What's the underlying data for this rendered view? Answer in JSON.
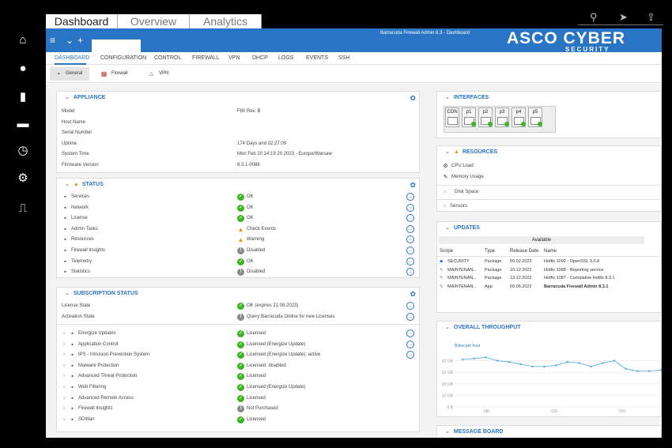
{
  "browser_tabs": [
    "Dashboard",
    "Overview",
    "Analytics"
  ],
  "window_title": "Barracuda Firewall Admin 8.3 - Dashboard",
  "logo": {
    "main": "ASCO CYBER",
    "sub": "SECURITY"
  },
  "nav": [
    "DASHBOARD",
    "CONFIGURATION",
    "CONTROL",
    "FIREWALL",
    "VPN",
    "DHCP",
    "LOGS",
    "EVENTS",
    "SSH"
  ],
  "subnav": [
    "General",
    "Firewall",
    "VPN"
  ],
  "appliance": {
    "title": "APPLIANCE",
    "rows": [
      {
        "label": "Model",
        "value": "F80 Rev. B"
      },
      {
        "label": "Host Name",
        "value": ""
      },
      {
        "label": "Serial Number",
        "value": ""
      },
      {
        "label": "Uptime",
        "value": "174 Days and 02:27:09"
      },
      {
        "label": "System Time",
        "value": "Mon Feb 20 14:19:20 2023 - Europe/Warsaw"
      },
      {
        "label": "Firmware Version",
        "value": "8.3.1-0086"
      }
    ]
  },
  "status": {
    "title": "STATUS",
    "rows": [
      {
        "label": "Services",
        "state": "ok",
        "text": "OK",
        "icon": "services-icon"
      },
      {
        "label": "Network",
        "state": "ok",
        "text": "OK",
        "icon": "network-icon"
      },
      {
        "label": "License",
        "state": "ok",
        "text": "OK",
        "icon": "license-icon"
      },
      {
        "label": "Admin Tasks",
        "state": "warn",
        "text": "Check Events",
        "icon": "admin-icon"
      },
      {
        "label": "Resources",
        "state": "warn",
        "text": "Warning",
        "icon": "resources-icon"
      },
      {
        "label": "Firewall Insights",
        "state": "dis",
        "text": "Disabled",
        "icon": "insights-icon"
      },
      {
        "label": "Telemetry",
        "state": "ok",
        "text": "OK",
        "icon": "telemetry-icon"
      },
      {
        "label": "Statistics",
        "state": "dis",
        "text": "Disabled",
        "icon": "statistics-icon"
      }
    ]
  },
  "subscription": {
    "title": "SUBSCRIPTION STATUS",
    "top": [
      {
        "label": "License State",
        "state": "ok",
        "text": "OK (expires 21.08.2023)"
      },
      {
        "label": "Activation State",
        "state": "dis",
        "text": "Query Barracuda Online for new Licenses"
      }
    ],
    "rows": [
      {
        "label": "Energize Updates",
        "state": "ok",
        "text": "Licensed",
        "go": true
      },
      {
        "label": "Application Control",
        "state": "ok",
        "text": "Licensed (Energize Update)",
        "go": true
      },
      {
        "label": "IPS - Intrusion Prevention System",
        "state": "ok",
        "text": "Licensed (Energize Update): active",
        "go": true
      },
      {
        "label": "Malware Protection",
        "state": "ok",
        "text": "Licensed: disabled",
        "go": false
      },
      {
        "label": "Advanced Threat Protection",
        "state": "ok",
        "text": "Licensed",
        "go": false
      },
      {
        "label": "Web Filtering",
        "state": "ok",
        "text": "Licensed (Energize Update)",
        "go": false
      },
      {
        "label": "Advanced Remote Access",
        "state": "ok",
        "text": "Licensed",
        "go": false
      },
      {
        "label": "Firewall Insights",
        "state": "dis",
        "text": "Not Purchased",
        "go": false
      },
      {
        "label": "SDWan",
        "state": "ok",
        "text": "Licensed",
        "go": false
      }
    ]
  },
  "interfaces": {
    "title": "INTERFACES",
    "ports": [
      "CON",
      "p1",
      "p2",
      "p3",
      "p4",
      "p5"
    ]
  },
  "resources": {
    "title": "RESOURCES",
    "items": [
      "CPU Load",
      "Memory Usage",
      "Disk Space",
      "Sensors"
    ]
  },
  "updates": {
    "title": "UPDATES",
    "available": "Available",
    "headers": [
      "Scope",
      "Type",
      "Release Date",
      "Name"
    ],
    "rows": [
      [
        "SECURITY",
        "Package",
        "09.02.2023",
        "Hotfix 1092 - OpenSSL 3.0.8"
      ],
      [
        "MAINTENAN...",
        "Package",
        "19.12.2022",
        "Hotfix 1088 - Reporting service"
      ],
      [
        "MAINTENAN...",
        "Package",
        "13.12.2022",
        "Hotfix 1087 - Cumulative Hotfix 8.3.1"
      ],
      [
        "MAINTENAN...",
        "App",
        "09.06.2022",
        "Barracuda Firewall Admin 8.3.1"
      ]
    ]
  },
  "throughput": {
    "title": "OVERALL THROUGHPUT"
  },
  "message_board": {
    "title": "MESSAGE BOARD"
  },
  "chart_data": {
    "type": "line",
    "series_label": "Bytes per hour",
    "y_ticks": [
      "40 GB",
      "30 GB",
      "20 GB",
      "10 GB",
      "0 B"
    ],
    "ylim": [
      0,
      50
    ],
    "x_ticks": [
      "18h",
      "22h",
      "02h"
    ],
    "series": [
      {
        "values": [
          41,
          42,
          43,
          40,
          39,
          37,
          35,
          35,
          36,
          39,
          38,
          35,
          38,
          40,
          33,
          31,
          31,
          32
        ]
      }
    ]
  },
  "colors": {
    "accent": "#2a74c4",
    "ok": "#3cb521",
    "warn": "#e8900a"
  }
}
